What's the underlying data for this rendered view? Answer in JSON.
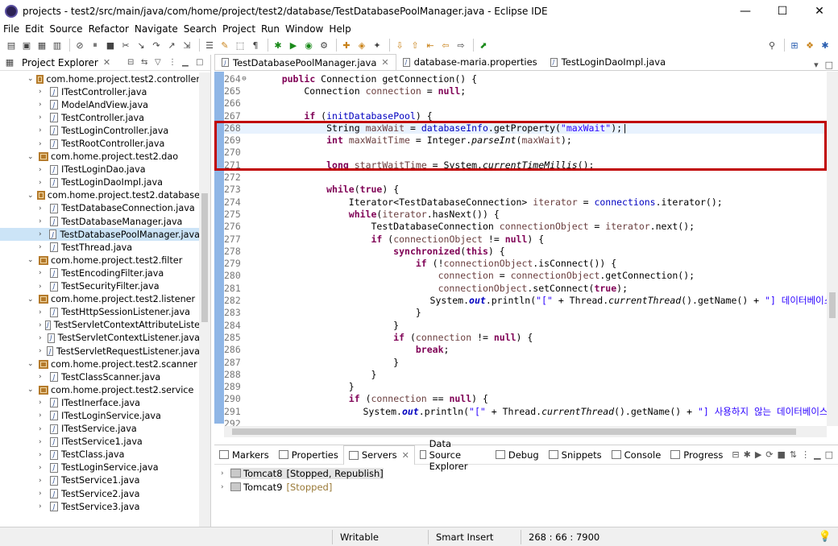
{
  "window": {
    "title": "projects - test2/src/main/java/com/home/project/test2/database/TestDatabasePoolManager.java - Eclipse IDE",
    "minimize": "—",
    "maximize": "☐",
    "close": "✕"
  },
  "menu": [
    "File",
    "Edit",
    "Source",
    "Refactor",
    "Navigate",
    "Search",
    "Project",
    "Run",
    "Window",
    "Help"
  ],
  "explorer": {
    "title": "Project Explorer",
    "close": "✕",
    "tree": [
      {
        "type": "pkg",
        "label": "com.home.project.test2.controller"
      },
      {
        "type": "file",
        "label": "ITestController.java"
      },
      {
        "type": "file",
        "label": "ModelAndView.java"
      },
      {
        "type": "file",
        "label": "TestController.java"
      },
      {
        "type": "file",
        "label": "TestLoginController.java"
      },
      {
        "type": "file",
        "label": "TestRootController.java"
      },
      {
        "type": "pkg",
        "label": "com.home.project.test2.dao"
      },
      {
        "type": "file",
        "label": "ITestLoginDao.java"
      },
      {
        "type": "file",
        "label": "TestLoginDaoImpl.java"
      },
      {
        "type": "pkg",
        "label": "com.home.project.test2.database"
      },
      {
        "type": "file",
        "label": "TestDatabaseConnection.java"
      },
      {
        "type": "file",
        "label": "TestDatabaseManager.java"
      },
      {
        "type": "file",
        "label": "TestDatabasePoolManager.java",
        "selected": true
      },
      {
        "type": "file",
        "label": "TestThread.java"
      },
      {
        "type": "pkg",
        "label": "com.home.project.test2.filter"
      },
      {
        "type": "file",
        "label": "TestEncodingFilter.java"
      },
      {
        "type": "file",
        "label": "TestSecurityFilter.java"
      },
      {
        "type": "pkg",
        "label": "com.home.project.test2.listener"
      },
      {
        "type": "file",
        "label": "TestHttpSessionListener.java"
      },
      {
        "type": "file",
        "label": "TestServletContextAttributeListe"
      },
      {
        "type": "file",
        "label": "TestServletContextListener.java"
      },
      {
        "type": "file",
        "label": "TestServletRequestListener.java"
      },
      {
        "type": "pkg",
        "label": "com.home.project.test2.scanner"
      },
      {
        "type": "file",
        "label": "TestClassScanner.java"
      },
      {
        "type": "pkg",
        "label": "com.home.project.test2.service"
      },
      {
        "type": "file",
        "label": "ITestInerface.java"
      },
      {
        "type": "file",
        "label": "ITestLoginService.java"
      },
      {
        "type": "file",
        "label": "ITestService.java"
      },
      {
        "type": "file",
        "label": "ITestService1.java"
      },
      {
        "type": "file",
        "label": "TestClass.java"
      },
      {
        "type": "file",
        "label": "TestLoginService.java"
      },
      {
        "type": "file",
        "label": "TestService1.java"
      },
      {
        "type": "file",
        "label": "TestService2.java"
      },
      {
        "type": "file",
        "label": "TestService3.java"
      }
    ]
  },
  "editor": {
    "tabs": [
      {
        "label": "TestDatabasePoolManager.java",
        "active": true,
        "close": "✕"
      },
      {
        "label": "database-maria.properties",
        "active": false
      },
      {
        "label": "TestLoginDaoImpl.java",
        "active": false
      }
    ],
    "tab_tools": [
      "▾",
      "□"
    ],
    "lines": [
      {
        "n": "264",
        "fold": "⊖",
        "html": "    <span class='kw'>public</span> Connection getConnection() {"
      },
      {
        "n": "265",
        "html": "        Connection <span class='var'>connection</span> = <span class='kw'>null</span>;"
      },
      {
        "n": "266",
        "html": ""
      },
      {
        "n": "267",
        "html": "        <span class='kw'>if</span> (<span class='fld'>initDatabasePool</span>) {"
      },
      {
        "n": "268",
        "current": true,
        "html": "            String <span class='var'>maxWait</span> = <span class='fld'>databaseInfo</span>.getProperty(<span class='str'>\"maxWait\"</span>);|"
      },
      {
        "n": "269",
        "html": "            <span class='kw'>int</span> <span class='var'>maxWaitTime</span> = Integer.<span class='itl'>parseInt</span>(<span class='var'>maxWait</span>);"
      },
      {
        "n": "270",
        "html": ""
      },
      {
        "n": "271",
        "html": "            <span class='kw'>long</span> <span class='var'>startWaitTime</span> = System.<span class='itl'>currentTimeMillis</span>();"
      },
      {
        "n": "272",
        "html": ""
      },
      {
        "n": "273",
        "html": "            <span class='kw'>while</span>(<span class='kw'>true</span>) {"
      },
      {
        "n": "274",
        "html": "                Iterator&lt;TestDatabaseConnection&gt; <span class='var'>iterator</span> = <span class='fld'>connections</span>.iterator();"
      },
      {
        "n": "275",
        "html": "                <span class='kw'>while</span>(<span class='var'>iterator</span>.hasNext()) {"
      },
      {
        "n": "276",
        "html": "                    TestDatabaseConnection <span class='var'>connectionObject</span> = <span class='var'>iterator</span>.next();"
      },
      {
        "n": "277",
        "html": "                    <span class='kw'>if</span> (<span class='var'>connectionObject</span> != <span class='kw'>null</span>) {"
      },
      {
        "n": "278",
        "html": "                        <span class='kw'>synchronized</span>(<span class='kw'>this</span>) {"
      },
      {
        "n": "279",
        "html": "                            <span class='kw'>if</span> (!<span class='var'>connectionObject</span>.isConnect()) {"
      },
      {
        "n": "280",
        "html": "                                <span class='var'>connection</span> = <span class='var'>connectionObject</span>.getConnection();"
      },
      {
        "n": "281",
        "html": "                                <span class='var'>connectionObject</span>.setConnect(<span class='kw'>true</span>);"
      },
      {
        "n": "282",
        "html": "                                System.<span class='fldi'>out</span>.println(<span class='str'>\"[\"</span> + Thread.<span class='itl'>currentThread</span>().getName() + <span class='str'>\"] 데이터베이스 커</span>"
      },
      {
        "n": "283",
        "html": "                            }"
      },
      {
        "n": "284",
        "html": "                        }"
      },
      {
        "n": "285",
        "html": "                        <span class='kw'>if</span> (<span class='var'>connection</span> != <span class='kw'>null</span>) {"
      },
      {
        "n": "286",
        "html": "                            <span class='kw'>break</span>;"
      },
      {
        "n": "287",
        "html": "                        }"
      },
      {
        "n": "288",
        "html": "                    }"
      },
      {
        "n": "289",
        "html": "                }"
      },
      {
        "n": "290",
        "html": "                <span class='kw'>if</span> (<span class='var'>connection</span> == <span class='kw'>null</span>) {"
      },
      {
        "n": "291",
        "html": "                    System.<span class='fldi'>out</span>.println(<span class='str'>\"[\"</span> + Thread.<span class='itl'>currentThread</span>().getName() + <span class='str'>\"] 사용하지 않는 데이터베이스 커</span>"
      },
      {
        "n": "292",
        "html": ""
      }
    ]
  },
  "bottom": {
    "tabs": [
      {
        "label": "Markers"
      },
      {
        "label": "Properties"
      },
      {
        "label": "Servers",
        "active": true,
        "close": "✕"
      },
      {
        "label": "Data Source Explorer"
      },
      {
        "label": "Debug"
      },
      {
        "label": "Snippets"
      },
      {
        "label": "Console"
      },
      {
        "label": "Progress"
      }
    ],
    "servers": [
      {
        "name": "Tomcat8",
        "status": "[Stopped, Republish]",
        "selected": true
      },
      {
        "name": "Tomcat9",
        "status": "[Stopped]",
        "selected": false
      }
    ]
  },
  "status": {
    "writable": "Writable",
    "insert_mode": "Smart Insert",
    "position": "268 : 66 : 7900"
  },
  "colors": {
    "highlight_box": "#c00000",
    "keyword": "#7f0055",
    "string": "#2a00ff",
    "field": "#0000c0",
    "local_var": "#6a3e3e"
  }
}
